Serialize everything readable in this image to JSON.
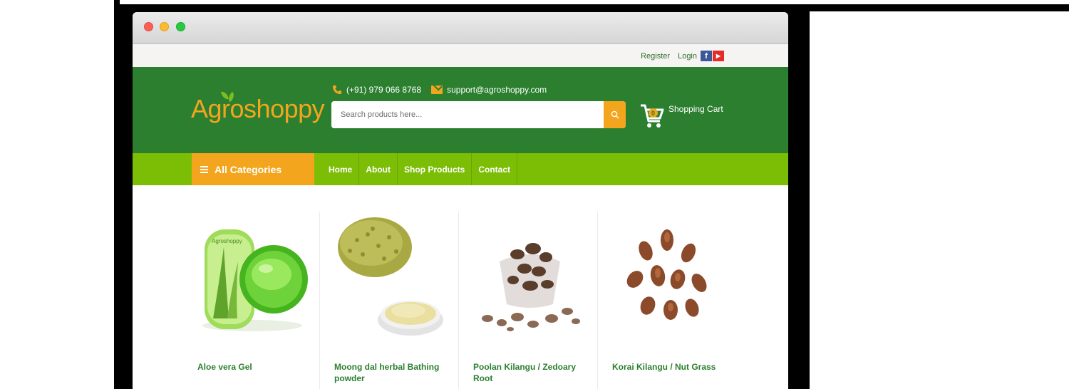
{
  "topbar": {
    "register": "Register",
    "login": "Login",
    "facebook_icon": "f",
    "youtube_icon": "▶"
  },
  "header": {
    "logo": "Agroshoppy",
    "phone": "(+91) 979 066 8768",
    "email": "support@agroshoppy.com",
    "search_placeholder": "Search products here...",
    "cart_label": "Shopping Cart",
    "cart_count": "0"
  },
  "nav": {
    "all_categories": "All Categories",
    "items": [
      "Home",
      "About",
      "Shop Products",
      "Contact"
    ]
  },
  "products": [
    {
      "name": "Aloe vera Gel",
      "image": "aloe-vera-gel-jar"
    },
    {
      "name": "Moong dal herbal Bathing powder",
      "image": "moong-dal-powder"
    },
    {
      "name": "Poolan Kilangu / Zedoary Root",
      "image": "zedoary-root"
    },
    {
      "name": "Korai Kilangu / Nut Grass",
      "image": "nut-grass"
    }
  ],
  "colors": {
    "header_green": "#2b7f2f",
    "nav_green": "#7cbd06",
    "accent_orange": "#f3a51e"
  }
}
